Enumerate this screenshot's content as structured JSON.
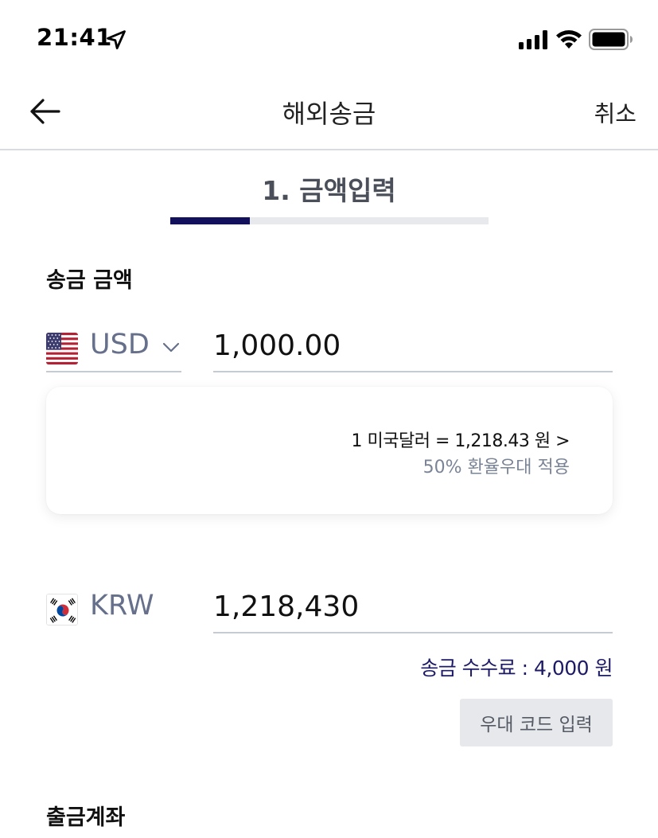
{
  "status_bar": {
    "time": "21:41",
    "icons": [
      "location-arrow-icon",
      "cellular-signal-icon",
      "wifi-icon",
      "battery-icon"
    ]
  },
  "nav": {
    "back_icon": "arrow-left-icon",
    "title": "해외송금",
    "cancel_label": "취소"
  },
  "step": {
    "title": "1. 금액입력",
    "progress": 0.25
  },
  "send_section": {
    "label": "송금 금액",
    "currency_code": "USD",
    "flag": "us-flag-icon",
    "dropdown_icon": "chevron-down-icon",
    "amount": "1,000.00"
  },
  "rate_card": {
    "rate_text": "1 미국달러 = 1,218.43 원 >",
    "discount_text": "50% 환율우대 적용"
  },
  "receive_section": {
    "currency_code": "KRW",
    "flag": "kr-flag-icon",
    "amount": "1,218,430",
    "fee_text": "송금 수수료 : 4,000 원",
    "promo_button_label": "우대 코드 입력"
  },
  "account_section": {
    "label": "출금계좌"
  },
  "colors": {
    "accent": "#14115c",
    "fee_text": "#1d1a66",
    "muted": "#66708a",
    "divider": "#c5cad3"
  }
}
